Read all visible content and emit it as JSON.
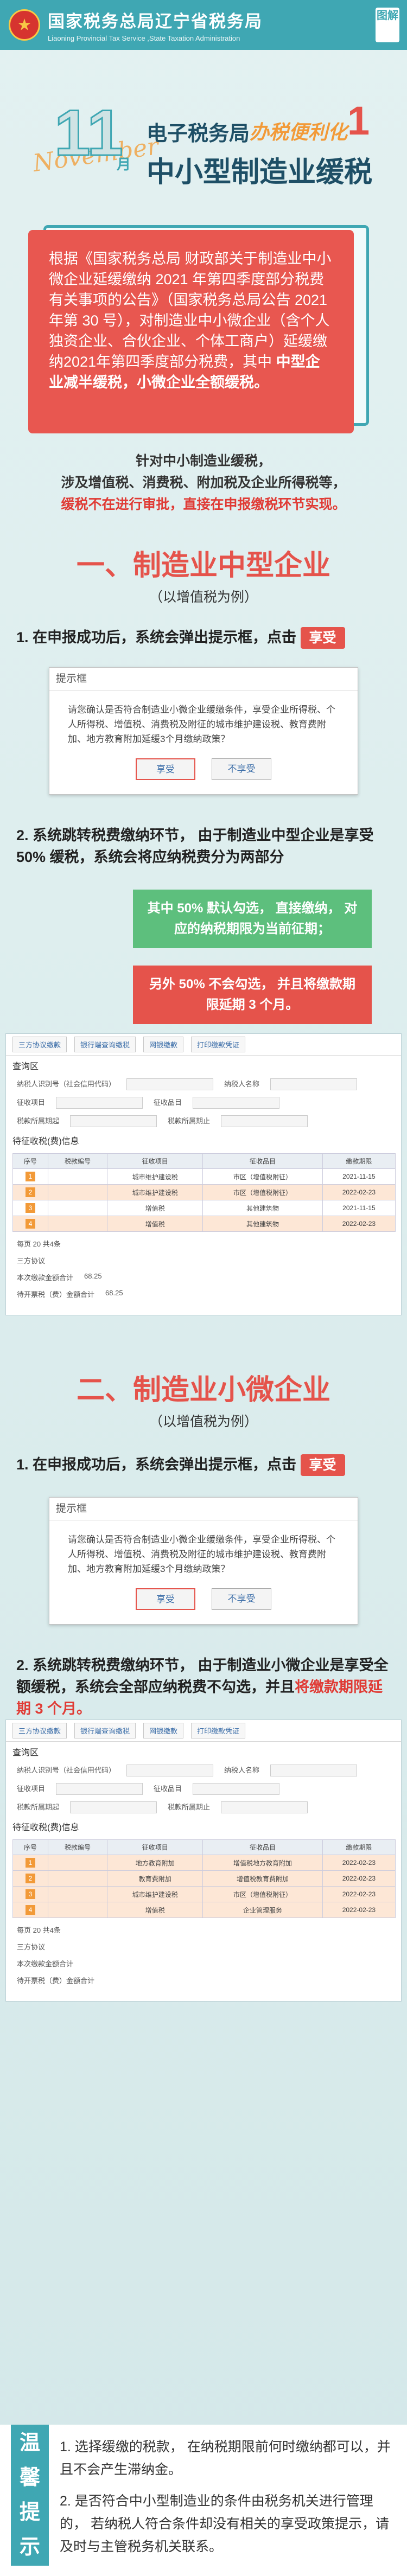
{
  "header": {
    "title_cn": "国家税务总局辽宁省税务局",
    "title_en": "Liaoning Provincial Tax Service ,State Taxation Administration",
    "tag": "图解"
  },
  "hero": {
    "number": "11",
    "month_label": "月",
    "november": "November",
    "dept": "电子税务局",
    "tag": "办税便利化",
    "badge": "1",
    "subtitle": "中小型制造业缓税"
  },
  "intro": {
    "text": "根据《国家税务总局 财政部关于制造业中小微企业延缓缴纳 2021 年第四季度部分税费有关事项的公告》（国家税务总局公告 2021 年第 30 号），对制造业中小微企业（含个人独资企业、合伙企业、个体工商户）延缓缴纳2021年第四季度部分税费，其中",
    "bold": "中型企业减半缓税，小微企业全额缓税。"
  },
  "notice": {
    "line1": "针对中小制造业缓税，",
    "line2": "涉及增值税、消费税、附加税及企业所得税等，",
    "line3": "缓税不在进行审批，直接在申报缴税环节实现。"
  },
  "section1": {
    "title": "一、制造业中型企业",
    "subtitle": "（以增值税为例）",
    "step1": "1. 在申报成功后，系统会弹出提示框，点击",
    "step1_btn": "享受",
    "step2": "2. 系统跳转税费缴纳环节， 由于制造业中型企业是享受 50% 缓税，系统会将应纳税费分为两部分",
    "callout1": "其中 50% 默认勾选， 直接缴纳， 对应的纳税期限为当前征期；",
    "callout2": "另外 50% 不会勾选， 并且将缴款期限延期 3 个月。"
  },
  "dialog": {
    "title": "提示框",
    "body": "请您确认是否符合制造业小微企业缓缴条件，享受企业所得税、个人所得税、增值税、消费税及附征的城市维护建设税、教育费附加、地方教育附加延缓3个月缴纳政策？",
    "ok": "享受",
    "cancel": "不享受"
  },
  "shot": {
    "toolbar": [
      "三方协议缴款",
      "银行端查询缴税",
      "网银缴款",
      "打印缴款凭证"
    ],
    "query": "查询区",
    "field1": "纳税人识别号（社会信用代码）",
    "field2": "纳税人名称",
    "field3": "征收项目",
    "field4": "征收品目",
    "field5": "税款所属期起",
    "field6": "税款所属期止",
    "list": "待征收税(费)信息",
    "cols": [
      "序号",
      "税款编号",
      "征收项目",
      "征收品目",
      "缴款期限"
    ],
    "rows": [
      {
        "n": "1",
        "proj": "城市维护建设税",
        "item": "市区（增值税附征）",
        "date": "2021-11-15"
      },
      {
        "n": "2",
        "proj": "城市维护建设税",
        "item": "市区（增值税附征）",
        "date": "2022-02-23"
      },
      {
        "n": "3",
        "proj": "增值税",
        "item": "其他建筑物",
        "date": "2021-11-15"
      },
      {
        "n": "4",
        "proj": "增值税",
        "item": "其他建筑物",
        "date": "2022-02-23"
      }
    ],
    "pager": "每页 20 共4条",
    "sum1": "三方协议",
    "sum2": "本次缴款金额合计",
    "sum2_val": "68.25",
    "sum3": "待开票税（费）金额合计",
    "sum3_val": "68.25"
  },
  "section2": {
    "title": "二、制造业小微企业",
    "subtitle": "（以增值税为例）",
    "step1": "1. 在申报成功后，系统会弹出提示框，点击",
    "step1_btn": "享受",
    "step2": "2. 系统跳转税费缴纳环节， 由于制造业小微企业是享受全额缓税，系统会全部应纳税费不勾选，并且",
    "step2_red": "将缴款期限延期 3 个月。"
  },
  "shot2": {
    "rows": [
      {
        "n": "1",
        "proj": "地方教育附加",
        "item": "增值税地方教育附加",
        "date": "2022-02-23"
      },
      {
        "n": "2",
        "proj": "教育费附加",
        "item": "增值税教育费附加",
        "date": "2022-02-23"
      },
      {
        "n": "3",
        "proj": "城市维护建设税",
        "item": "市区（增值税附征）",
        "date": "2022-02-23"
      },
      {
        "n": "4",
        "proj": "增值税",
        "item": "企业管理服务",
        "date": "2022-02-23"
      }
    ]
  },
  "tips": {
    "badge": "温馨提示",
    "t1": "1. 选择缓缴的税款， 在纳税期限前何时缴纳都可以，并且不会产生滞纳金。",
    "t2": "2. 是否符合中小型制造业的条件由税务机关进行管理的， 若纳税人符合条件却没有相关的享受政策提示，请及时与主管税务机关联系。"
  },
  "colors": {
    "teal": "#3fa7b3",
    "red": "#e5534b",
    "green": "#5dbf7d"
  }
}
